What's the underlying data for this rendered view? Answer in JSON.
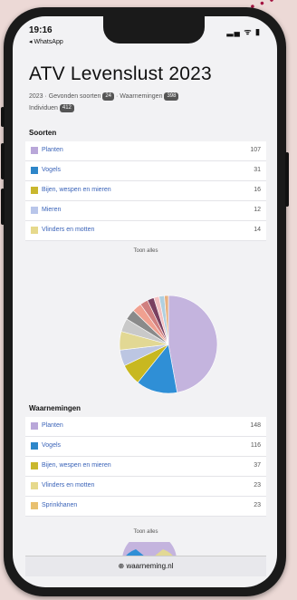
{
  "status": {
    "time": "19:16",
    "icons": "▂▄ ᯤ ▮"
  },
  "back_label": "◂ WhatsApp",
  "title": "ATV Levenslust 2023",
  "meta": {
    "pre1": "2023 · Gevonden soorten",
    "badge1": "24",
    "pre2": " · Waarnemingen",
    "badge2": "398",
    "pre3": "Individuen",
    "badge3": "412"
  },
  "species_section": {
    "title": "Soorten",
    "rows": [
      {
        "label": "Planten",
        "count": "107",
        "color": "#b9a7d9"
      },
      {
        "label": "Vogels",
        "count": "31",
        "color": "#2e86c9"
      },
      {
        "label": "Bijen, wespen en mieren",
        "count": "16",
        "color": "#c9b72e"
      },
      {
        "label": "Mieren",
        "count": "12",
        "color": "#b9c6ea"
      },
      {
        "label": "Vlinders en motten",
        "count": "14",
        "color": "#e6d98c"
      }
    ],
    "more": "Toon alles"
  },
  "pie_data": {
    "values": [
      107,
      31,
      16,
      12,
      14,
      10,
      8,
      7,
      6,
      5,
      4,
      4,
      3
    ],
    "colors": [
      "#c4b4de",
      "#2f8fd6",
      "#c8b820",
      "#bcc6e2",
      "#e2d894",
      "#c9c9c9",
      "#8a8a8a",
      "#f0a090",
      "#d08080",
      "#7a4060",
      "#f4c2c2",
      "#b0d0e0",
      "#e8b080"
    ]
  },
  "obs_section": {
    "title": "Waarnemingen",
    "rows": [
      {
        "label": "Planten",
        "count": "148",
        "color": "#b9a7d9"
      },
      {
        "label": "Vogels",
        "count": "116",
        "color": "#2e86c9"
      },
      {
        "label": "Bijen, wespen en mieren",
        "count": "37",
        "color": "#c9b72e"
      },
      {
        "label": "Vlinders en motten",
        "count": "23",
        "color": "#e6d98c"
      },
      {
        "label": "Sprinkhanen",
        "count": "23",
        "color": "#e8c070"
      }
    ],
    "more": "Toon alles"
  },
  "bottom_bar": "⊕ waarneming.nl",
  "accent_dots": "#a4123f"
}
